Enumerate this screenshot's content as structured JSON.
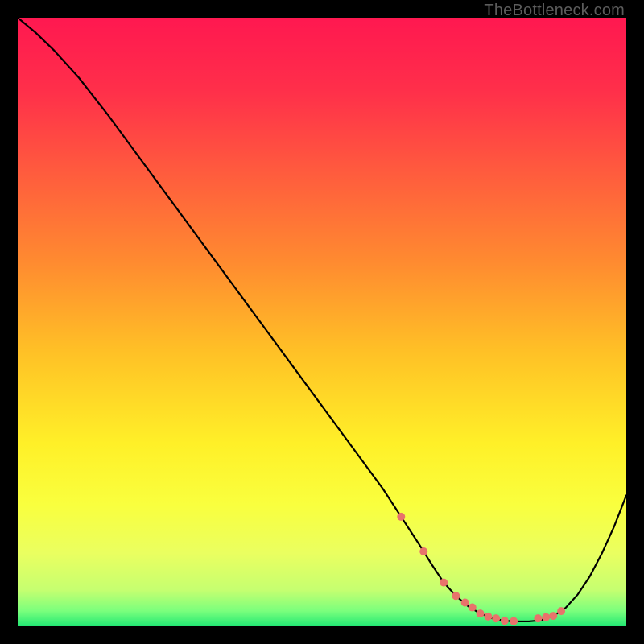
{
  "watermark": "TheBottleneck.com",
  "chart_data": {
    "type": "line",
    "title": "",
    "xlabel": "",
    "ylabel": "",
    "xlim": [
      0,
      100
    ],
    "ylim": [
      0,
      100
    ],
    "grid": false,
    "legend": false,
    "series": [
      {
        "name": "curve",
        "x": [
          0,
          3,
          6,
          10,
          15,
          20,
          25,
          30,
          35,
          40,
          45,
          50,
          55,
          60,
          63,
          66,
          68,
          70,
          72,
          74,
          76,
          78,
          80,
          82,
          84,
          86,
          88,
          90,
          92,
          94,
          96,
          98,
          100
        ],
        "y": [
          100,
          97.5,
          94.6,
          90.2,
          83.8,
          77.0,
          70.2,
          63.4,
          56.6,
          49.8,
          43.0,
          36.2,
          29.4,
          22.6,
          18.0,
          13.4,
          10.2,
          7.2,
          5.0,
          3.3,
          2.1,
          1.3,
          0.9,
          0.8,
          0.8,
          1.0,
          1.7,
          3.0,
          5.2,
          8.2,
          12.0,
          16.4,
          21.5
        ],
        "color": "#000000",
        "width": 2.2
      }
    ],
    "markers": {
      "name": "highlight-points",
      "x": [
        63.0,
        66.7,
        70.0,
        72.0,
        73.5,
        74.7,
        76.0,
        77.3,
        78.6,
        80.0,
        81.5,
        85.5,
        86.8,
        88.0,
        89.3
      ],
      "y": [
        18.0,
        12.3,
        7.2,
        5.0,
        3.9,
        3.1,
        2.1,
        1.6,
        1.3,
        0.9,
        0.85,
        1.3,
        1.5,
        1.7,
        2.5
      ],
      "color": "#e8736b",
      "radius": 5
    },
    "gradient_stops": [
      {
        "offset": 0.0,
        "color": "#ff1850"
      },
      {
        "offset": 0.12,
        "color": "#ff2f4a"
      },
      {
        "offset": 0.25,
        "color": "#ff5a3e"
      },
      {
        "offset": 0.4,
        "color": "#ff8a30"
      },
      {
        "offset": 0.55,
        "color": "#ffc126"
      },
      {
        "offset": 0.7,
        "color": "#fff028"
      },
      {
        "offset": 0.8,
        "color": "#f9ff3e"
      },
      {
        "offset": 0.88,
        "color": "#eaff60"
      },
      {
        "offset": 0.94,
        "color": "#c6ff70"
      },
      {
        "offset": 0.975,
        "color": "#7aff7d"
      },
      {
        "offset": 1.0,
        "color": "#22e873"
      }
    ]
  }
}
